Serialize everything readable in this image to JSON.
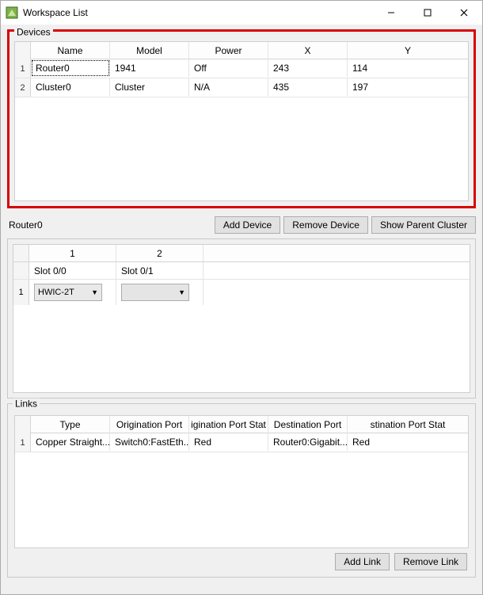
{
  "window": {
    "title": "Workspace List"
  },
  "devices": {
    "group_label": "Devices",
    "headers": {
      "name": "Name",
      "model": "Model",
      "power": "Power",
      "x": "X",
      "y": "Y"
    },
    "rows": [
      {
        "num": "1",
        "name": "Router0",
        "model": "1941",
        "power": "Off",
        "x": "243",
        "y": "114"
      },
      {
        "num": "2",
        "name": "Cluster0",
        "model": "Cluster",
        "power": "N/A",
        "x": "435",
        "y": "197"
      }
    ]
  },
  "selected_device_label": "Router0",
  "buttons": {
    "add_device": "Add Device",
    "remove_device": "Remove Device",
    "show_parent": "Show Parent Cluster",
    "add_link": "Add Link",
    "remove_link": "Remove Link"
  },
  "slots": {
    "col_headers": {
      "c1": "1",
      "c2": "2"
    },
    "labels": {
      "slot0": "Slot 0/0",
      "slot1": "Slot 0/1"
    },
    "row_num": "1",
    "values": {
      "slot0": "HWIC-2T",
      "slot1": ""
    }
  },
  "links": {
    "group_label": "Links",
    "headers": {
      "type": "Type",
      "orig_port": "Origination Port",
      "orig_status": "igination Port Stat",
      "dest_port": "Destination Port",
      "dest_status": "stination Port Stat"
    },
    "rows": [
      {
        "num": "1",
        "type": "Copper Straight...",
        "orig_port": "Switch0:FastEth...",
        "orig_status": "Red",
        "dest_port": "Router0:Gigabit...",
        "dest_status": "Red"
      }
    ]
  }
}
